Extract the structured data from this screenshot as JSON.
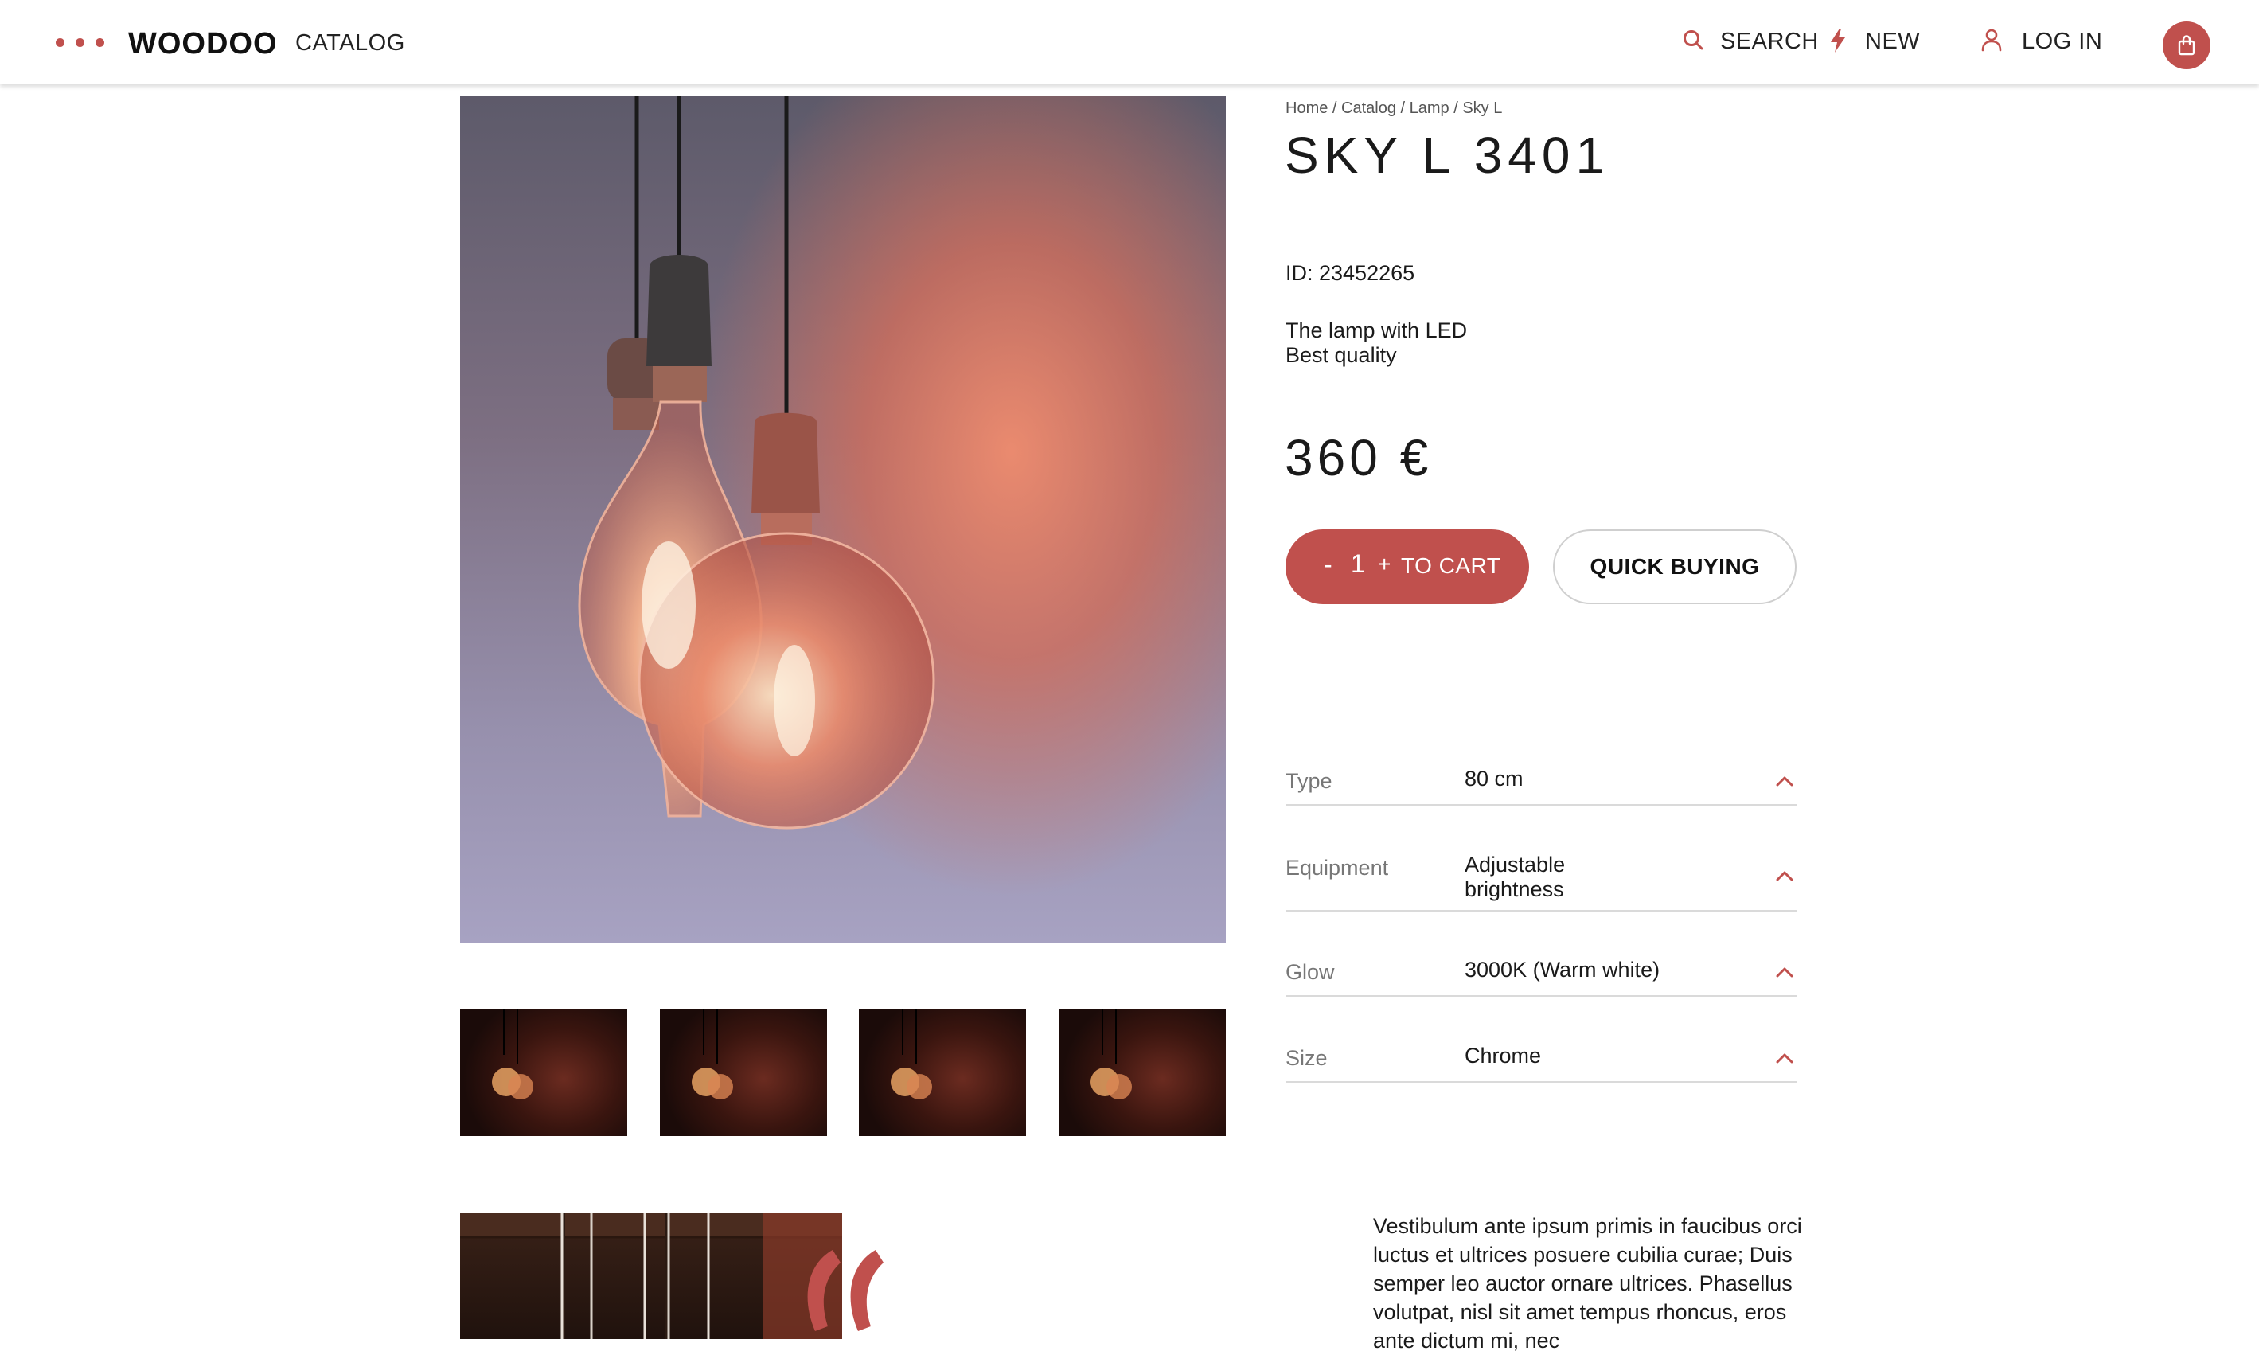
{
  "header": {
    "logo": "WOODOO",
    "catalog_label": "CATALOG",
    "search_label": "SEARCH",
    "new_label": "NEW",
    "login_label": "LOG IN",
    "menu_icon": "more-dots-icon",
    "cart_icon": "shopping-bag-icon"
  },
  "breadcrumb": [
    "Home",
    "Catalog",
    "Lamp",
    "Sky L"
  ],
  "product": {
    "title": "SKY L 3401",
    "id_text": "ID: 23452265",
    "description_line1": "The lamp with LED",
    "description_line2": "Best quality",
    "price": "360 €",
    "quantity": "1",
    "qty_minus": "-",
    "qty_plus": "+",
    "to_cart_label": "TO CART",
    "quick_buy_label": "QUICK BUYING"
  },
  "specs": [
    {
      "label": "Type",
      "value": "80 cm"
    },
    {
      "label": "Equipment",
      "value": "Adjustable brightness"
    },
    {
      "label": "Glow",
      "value": "3000K (Warm white)"
    },
    {
      "label": "Size",
      "value": "Chrome"
    }
  ],
  "article_text": "Vestibulum ante ipsum primis in faucibus orci luctus et ultrices posuere cubilia curae; Duis semper leo auctor ornare ultrices. Phasellus volutpat, nisl sit amet tempus rhoncus, eros ante dictum mi, nec",
  "colors": {
    "accent": "#c0504d",
    "text": "#1a1a1a",
    "muted": "#777777",
    "divider": "#dadada"
  }
}
